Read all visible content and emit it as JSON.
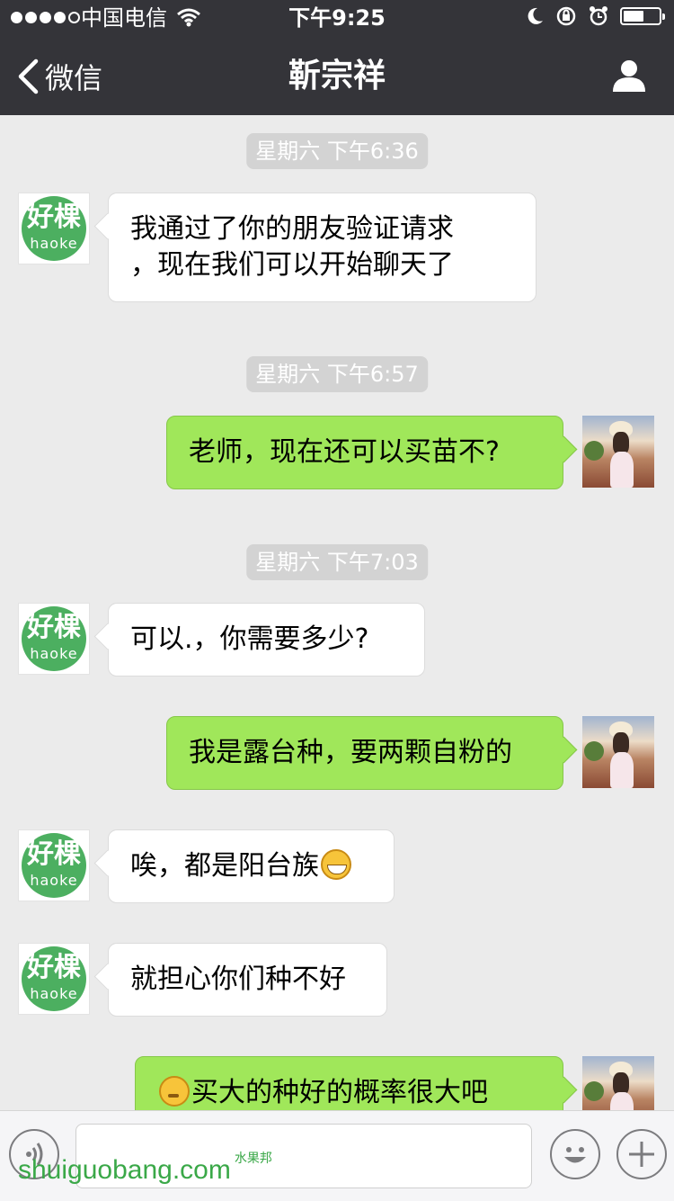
{
  "status_bar": {
    "carrier": "中国电信",
    "time": "下午9:25"
  },
  "nav": {
    "back_label": "微信",
    "title": "靳宗祥"
  },
  "brand_avatar": {
    "line1": "好棵",
    "line2": "haoke"
  },
  "messages": {
    "ts1": "星期六 下午6:36",
    "m1_line1": "我通过了你的朋友验证请求",
    "m1_line2": "，现在我们可以开始聊天了",
    "ts2": "星期六 下午6:57",
    "m2": "老师，现在还可以买苗不?",
    "ts3": "星期六 下午7:03",
    "m3": "可以.，你需要多少?",
    "m4": "我是露台种，要两颗自粉的",
    "m5": "唉，都是阳台族",
    "m6": "就担心你们种不好",
    "m7": "买大的种好的概率很大吧"
  },
  "input_bar": {
    "placeholder": ""
  },
  "watermark": {
    "main": "shuiguobang.com",
    "small": "水果邦"
  },
  "colors": {
    "topbar": "#343439",
    "background": "#ebebeb",
    "sent_bubble": "#a0e75a",
    "received_bubble": "#ffffff",
    "brand_green": "#4caf60"
  }
}
